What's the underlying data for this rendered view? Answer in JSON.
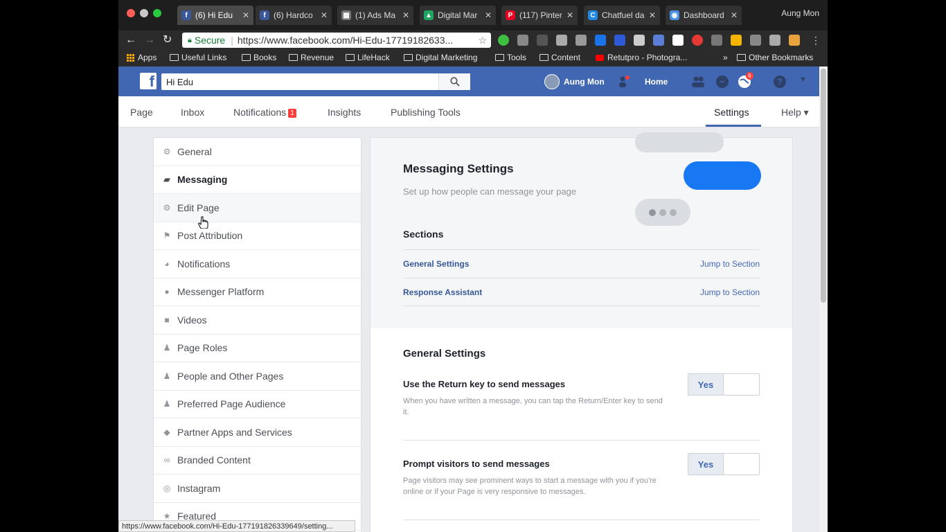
{
  "browser": {
    "profile_name": "Aung Mon",
    "tabs": [
      {
        "title": "(6) Hi Edu",
        "favicon": "facebook-icon",
        "color": "#3b5998",
        "glyph": "f",
        "active": true
      },
      {
        "title": "(6) Hardco",
        "favicon": "facebook-icon",
        "color": "#3b5998",
        "glyph": "f",
        "active": false
      },
      {
        "title": "(1) Ads Ma",
        "favicon": "ads-manager-icon",
        "color": "#777777",
        "glyph": "▦",
        "active": false
      },
      {
        "title": "Digital Mar",
        "favicon": "google-drive-icon",
        "color": "#1fa463",
        "glyph": "▲",
        "active": false
      },
      {
        "title": "(117) Pinter",
        "favicon": "pinterest-icon",
        "color": "#e60023",
        "glyph": "P",
        "active": false
      },
      {
        "title": "Chatfuel da",
        "favicon": "chatfuel-icon",
        "color": "#1e88e5",
        "glyph": "C",
        "active": false
      },
      {
        "title": "Dashboard",
        "favicon": "dashboard-icon",
        "color": "#4a90e2",
        "glyph": "◉",
        "active": false
      }
    ],
    "omnibox": {
      "secure_label": "Secure",
      "url": "https://www.facebook.com/Hi-Edu-17719182633..."
    },
    "bookmarks": [
      {
        "label": "Apps",
        "icon": "apps-grid-icon"
      },
      {
        "label": "Useful Links",
        "icon": "folder-icon"
      },
      {
        "label": "Books",
        "icon": "folder-icon"
      },
      {
        "label": "Revenue",
        "icon": "folder-icon"
      },
      {
        "label": "LifeHack",
        "icon": "folder-icon"
      },
      {
        "label": "Digital Marketing",
        "icon": "folder-icon"
      },
      {
        "label": "Tools",
        "icon": "folder-icon"
      },
      {
        "label": "Content",
        "icon": "folder-icon"
      },
      {
        "label": "Retutpro - Photogra...",
        "icon": "youtube-icon"
      },
      {
        "label": "»",
        "icon": "overflow-chevron-icon"
      },
      {
        "label": "Other Bookmarks",
        "icon": "folder-icon"
      }
    ],
    "status_url": "https://www.facebook.com/Hi-Edu-177191826339649/setting..."
  },
  "fb_header": {
    "search_value": "Hi Edu",
    "user_name": "Aung Mon",
    "home_label": "Home",
    "notification_count": "6",
    "brand_color": "#4267b2"
  },
  "page_nav": {
    "tabs": [
      {
        "label": "Page"
      },
      {
        "label": "Inbox"
      },
      {
        "label": "Notifications",
        "badge": "1"
      },
      {
        "label": "Insights"
      },
      {
        "label": "Publishing Tools"
      }
    ],
    "settings_label": "Settings",
    "help_label": "Help ▾"
  },
  "left_menu": [
    {
      "label": "General",
      "icon": "gear-icon",
      "glyph": "⚙"
    },
    {
      "label": "Messaging",
      "icon": "messaging-icon",
      "glyph": "▰",
      "active": true
    },
    {
      "label": "Edit Page",
      "icon": "gear-icon",
      "glyph": "⚙",
      "hover": true
    },
    {
      "label": "Post Attribution",
      "icon": "flag-icon",
      "glyph": "⚑"
    },
    {
      "label": "Notifications",
      "icon": "globe-icon",
      "glyph": "◕"
    },
    {
      "label": "Messenger Platform",
      "icon": "messenger-icon",
      "glyph": "●"
    },
    {
      "label": "Videos",
      "icon": "video-camera-icon",
      "glyph": "■"
    },
    {
      "label": "Page Roles",
      "icon": "person-icon",
      "glyph": "♟"
    },
    {
      "label": "People and Other Pages",
      "icon": "people-icon",
      "glyph": "♟"
    },
    {
      "label": "Preferred Page Audience",
      "icon": "audience-icon",
      "glyph": "♟"
    },
    {
      "label": "Partner Apps and Services",
      "icon": "cube-icon",
      "glyph": "◆"
    },
    {
      "label": "Branded Content",
      "icon": "handshake-icon",
      "glyph": "∞"
    },
    {
      "label": "Instagram",
      "icon": "instagram-icon",
      "glyph": "◎"
    },
    {
      "label": "Featured",
      "icon": "star-icon",
      "glyph": "★"
    }
  ],
  "messaging": {
    "title": "Messaging Settings",
    "subtitle": "Set up how people can message your page",
    "sections_heading": "Sections",
    "sections": [
      {
        "name": "General Settings",
        "action": "Jump to Section"
      },
      {
        "name": "Response Assistant",
        "action": "Jump to Section"
      }
    ],
    "general_settings_title": "General Settings",
    "settings": [
      {
        "title": "Use the Return key to send messages",
        "description": "When you have written a message, you can tap the Return/Enter key to send it.",
        "toggle_label": "Yes"
      },
      {
        "title": "Prompt visitors to send messages",
        "description": "Page visitors may see prominent ways to start a message with you if you're online or if your Page is very responsive to messages.",
        "toggle_label": "Yes"
      }
    ]
  }
}
